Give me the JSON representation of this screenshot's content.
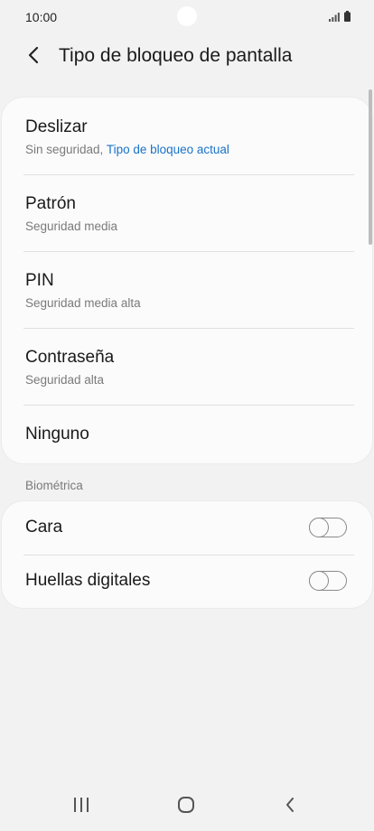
{
  "status_bar": {
    "time": "10:00",
    "signal_icon": "signal-icon",
    "battery_icon": "battery-icon"
  },
  "header": {
    "back_icon": "chevron-left-icon",
    "title": "Tipo de bloqueo de pantalla"
  },
  "lock_types": [
    {
      "title": "Deslizar",
      "subtitle": "Sin seguridad, ",
      "current_label": "Tipo de bloqueo actual"
    },
    {
      "title": "Patrón",
      "subtitle": "Seguridad media"
    },
    {
      "title": "PIN",
      "subtitle": "Seguridad media alta"
    },
    {
      "title": "Contraseña",
      "subtitle": "Seguridad alta"
    },
    {
      "title": "Ninguno"
    }
  ],
  "biometrics": {
    "section_label": "Biométrica",
    "items": [
      {
        "title": "Cara",
        "enabled": false
      },
      {
        "title": "Huellas digitales",
        "enabled": false
      }
    ]
  },
  "colors": {
    "accent": "#1a73c8",
    "background": "#f2f2f2",
    "card": "#fbfbfb"
  },
  "nav_bar": {
    "recent_icon": "recent-apps-icon",
    "home_icon": "home-icon",
    "back_icon": "back-icon"
  }
}
